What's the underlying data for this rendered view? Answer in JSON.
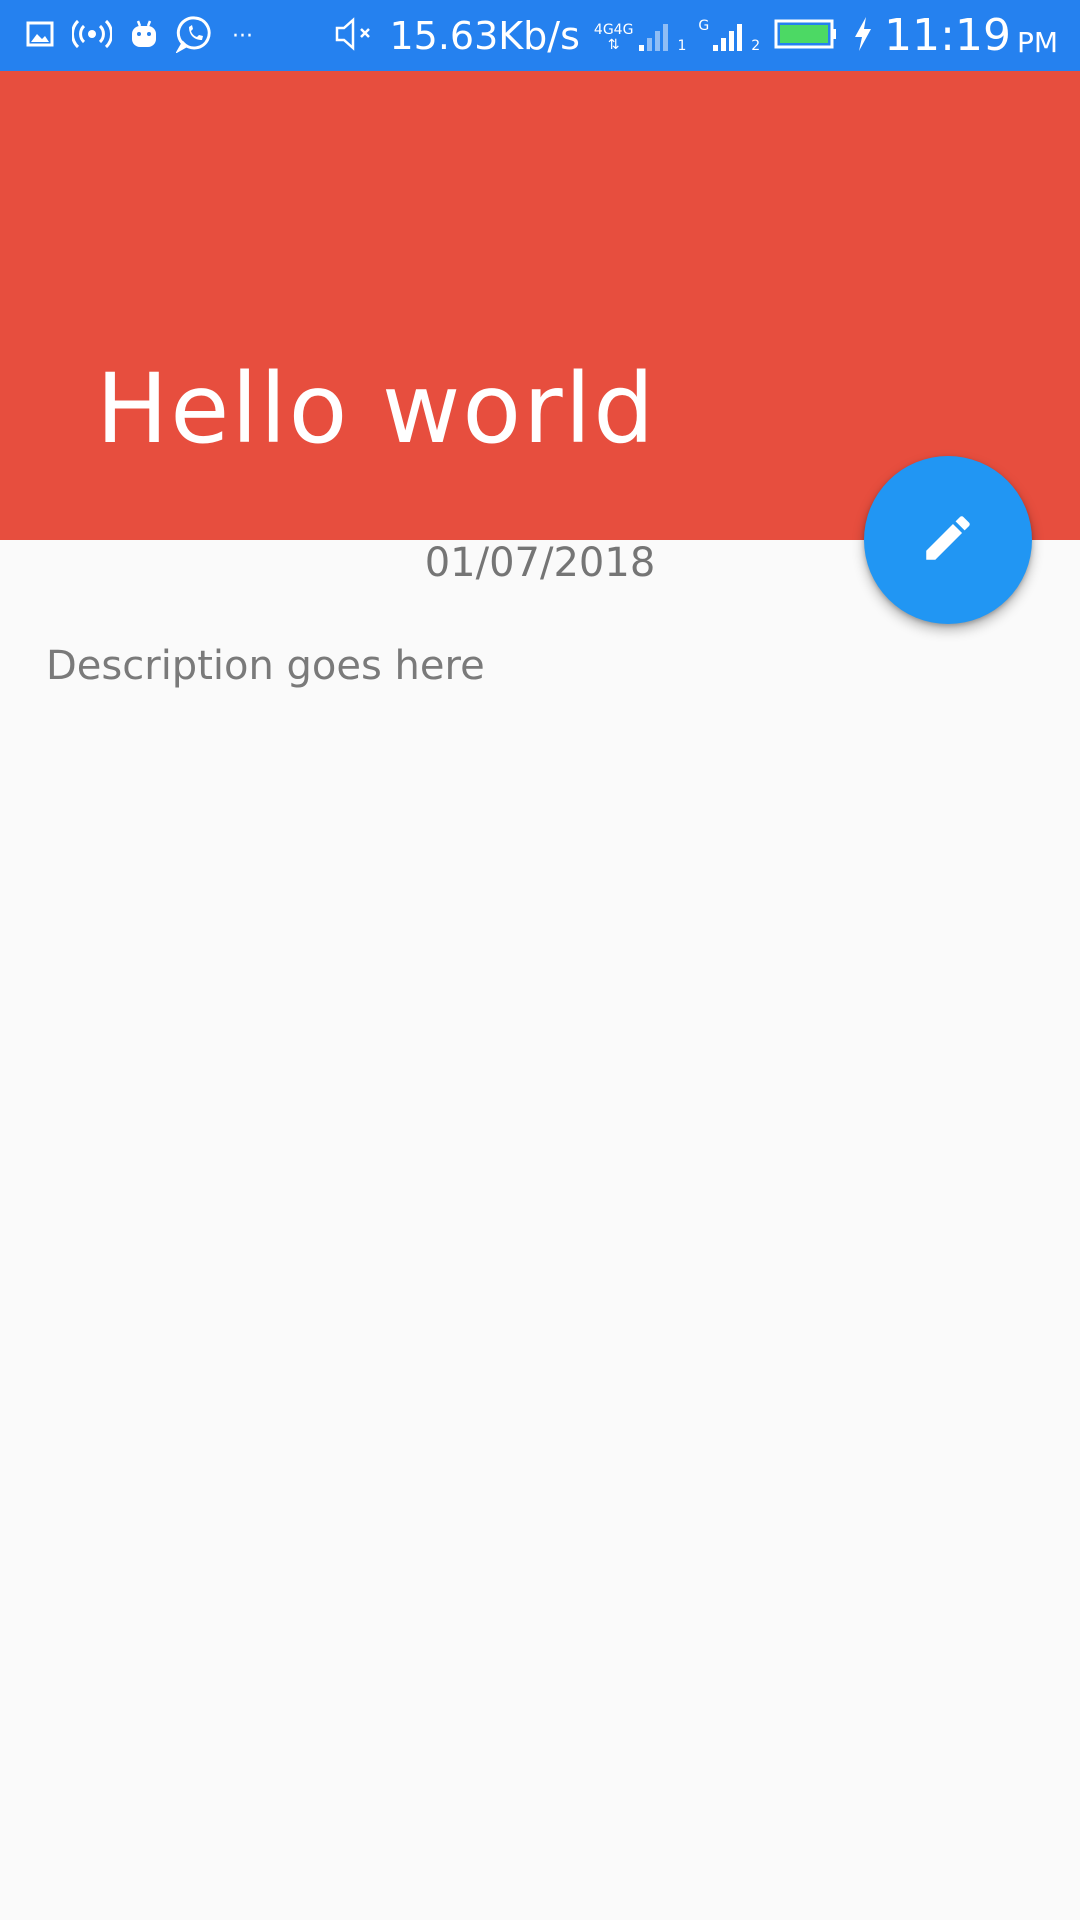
{
  "status_bar": {
    "bg_color": "#2581ef",
    "left_icons": [
      "gallery-icon",
      "hotspot-icon",
      "android-icon",
      "whatsapp-icon",
      "more-notifications-icon"
    ],
    "more_label": "···",
    "mute_icon": "mute-icon",
    "net_speed": "15.63Kb/s",
    "sim1": {
      "label_a": "4G",
      "label_b": "4G",
      "slot": "1"
    },
    "sim2": {
      "label": "G",
      "slot": "2"
    },
    "battery_icon": "battery-icon",
    "charging_icon": "charging-icon",
    "time": "11:19",
    "ampm": "PM"
  },
  "header": {
    "title": "Hello world",
    "bg_color": "#e74e3e"
  },
  "fab": {
    "icon": "edit-pencil-icon",
    "color": "#2196f3"
  },
  "content": {
    "date": "01/07/2018",
    "description": "Description goes here"
  }
}
